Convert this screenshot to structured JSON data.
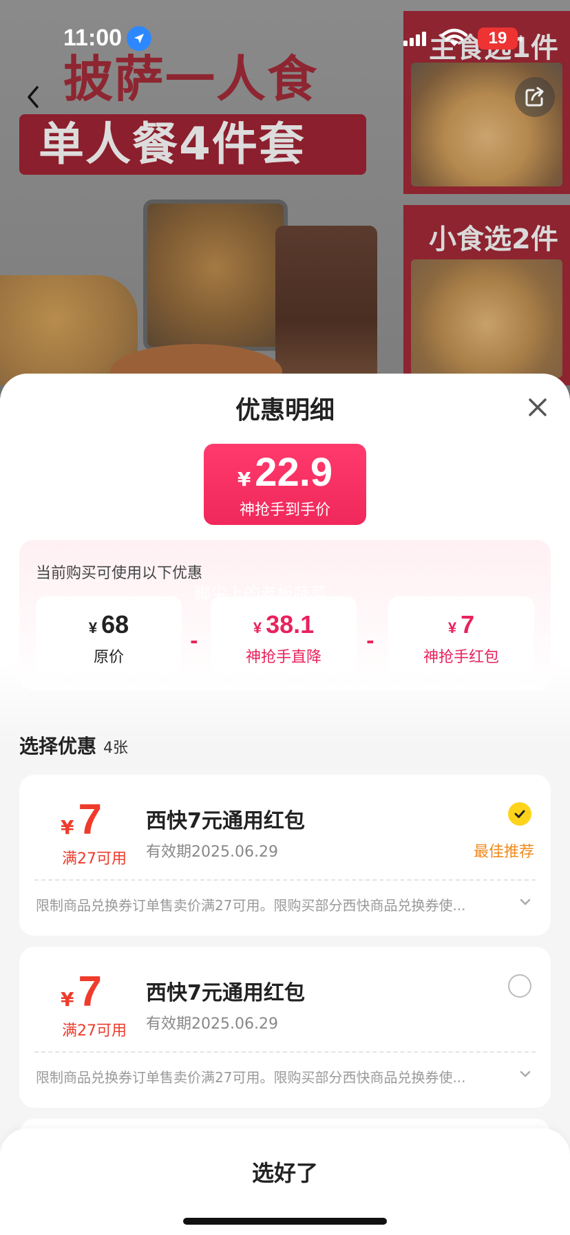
{
  "status_bar": {
    "time": "11:00",
    "battery": "19"
  },
  "promo": {
    "headline1": "披萨一人食",
    "headline2": "单人餐4件套",
    "panel1_label": "主食选1件",
    "panel2_label": "小食选2件"
  },
  "sheet": {
    "title": "优惠明细",
    "final_price": {
      "currency": "¥",
      "amount": "22.9",
      "label": "神抢手到手价"
    },
    "breakdown_hint": "当前购买可使用以下优惠",
    "watermark": "脚尖上的老板蔬菜",
    "breakdown": [
      {
        "currency": "¥",
        "value": "68",
        "label": "原价"
      },
      {
        "currency": "¥",
        "value": "38.1",
        "label": "神抢手直降"
      },
      {
        "currency": "¥",
        "value": "7",
        "label": "神抢手红包"
      }
    ],
    "operator": "-",
    "select_title": "选择优惠",
    "select_count": "4张",
    "coupons": [
      {
        "currency": "¥",
        "amount": "7",
        "condition": "满27可用",
        "name": "西快7元通用红包",
        "expiry": "有效期2025.06.29",
        "selected": true,
        "badge": "最佳推荐",
        "rule": "限制商品兑换券订单售卖价满27可用。限购买部分西快商品兑换券使..."
      },
      {
        "currency": "¥",
        "amount": "7",
        "condition": "满27可用",
        "name": "西快7元通用红包",
        "expiry": "有效期2025.06.29",
        "selected": false,
        "badge": "",
        "rule": "限制商品兑换券订单售卖价满27可用。限购买部分西快商品兑换券使..."
      }
    ],
    "confirm_label": "选好了"
  },
  "colors": {
    "accent": "#f0285b",
    "coupon_red": "#ee3b2c",
    "best_orange": "#f08a1d",
    "check_yellow": "#ffd31a"
  }
}
